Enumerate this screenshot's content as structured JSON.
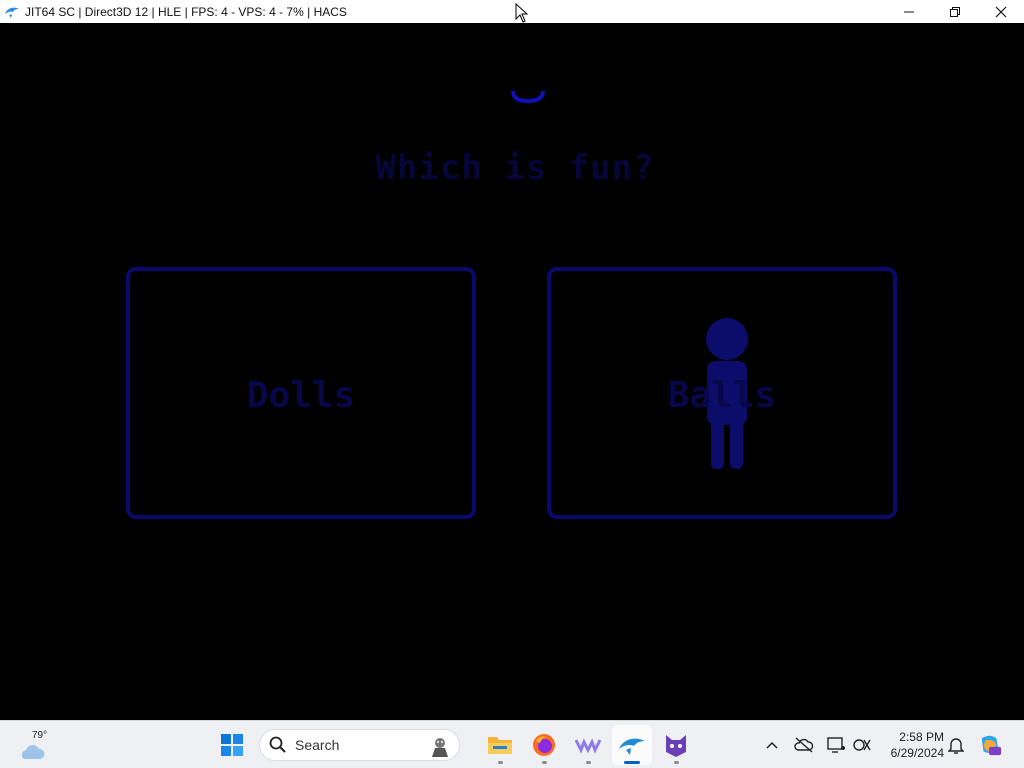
{
  "window": {
    "title": "JIT64 SC | Direct3D 12 | HLE | FPS: 4 - VPS: 4 - 7% | HACS",
    "controls": [
      "minimize",
      "restore",
      "close"
    ]
  },
  "game": {
    "heading": "Which is fun?",
    "choices": [
      {
        "label": "Dolls"
      },
      {
        "label": "Balls"
      }
    ]
  },
  "taskbar": {
    "weather": {
      "temp": "79°"
    },
    "search_placeholder": "Search",
    "apps": [
      "start",
      "search",
      "file-explorer",
      "firefox",
      "app-purple",
      "dolphin-emulator",
      "app-cat"
    ],
    "active_app": "dolphin-emulator",
    "clock": {
      "time": "2:58 PM",
      "date": "6/29/2024"
    },
    "tray": [
      "chevron-up",
      "cloud-off",
      "display",
      "network-off",
      "notifications",
      "copilot"
    ]
  },
  "colors": {
    "game_bg": "#000000",
    "frame_blue": "#0a0a6e",
    "label_blue": "#07074a",
    "taskbar_bg": "#eef0f4",
    "accent": "#0a5fc2"
  }
}
